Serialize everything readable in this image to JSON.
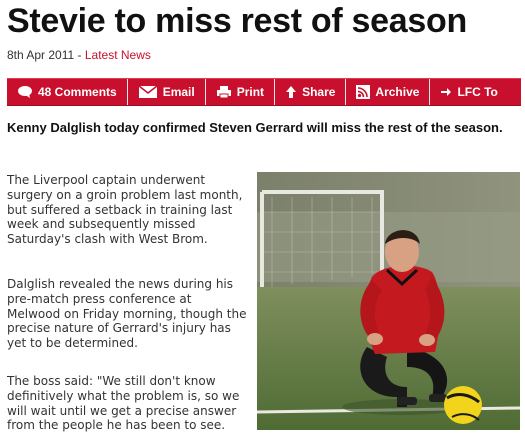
{
  "article": {
    "title": "Stevie to miss rest of season",
    "date": "8th Apr 2011",
    "date_separator": " - ",
    "category_link": "Latest News",
    "lede": "Kenny Dalglish today confirmed Steven Gerrard will miss the rest of the season.",
    "paragraphs": [
      "The Liverpool captain underwent surgery on a groin problem last month, but suffered a setback in training last week and subsequently missed Saturday's clash with West Brom.",
      "Dalglish revealed the news during his pre-match press conference at Melwood on Friday morning, though the precise nature of Gerrard's injury has yet to be determined.",
      "The boss said: \"We still don't know definitively what the problem is, so we will wait until we get a precise answer from the people he has been to see."
    ]
  },
  "toolbar": {
    "items": [
      {
        "label": "48 Comments",
        "icon": "comment-icon"
      },
      {
        "label": "Email",
        "icon": "envelope-icon"
      },
      {
        "label": "Print",
        "icon": "printer-icon"
      },
      {
        "label": "Share",
        "icon": "share-arrow-icon"
      },
      {
        "label": "Archive",
        "icon": "rss-icon"
      },
      {
        "label": "LFC To",
        "icon": "arrow-right-icon"
      }
    ]
  },
  "colors": {
    "accent": "#c8102e",
    "headline": "#111111",
    "body_text": "#333333"
  }
}
